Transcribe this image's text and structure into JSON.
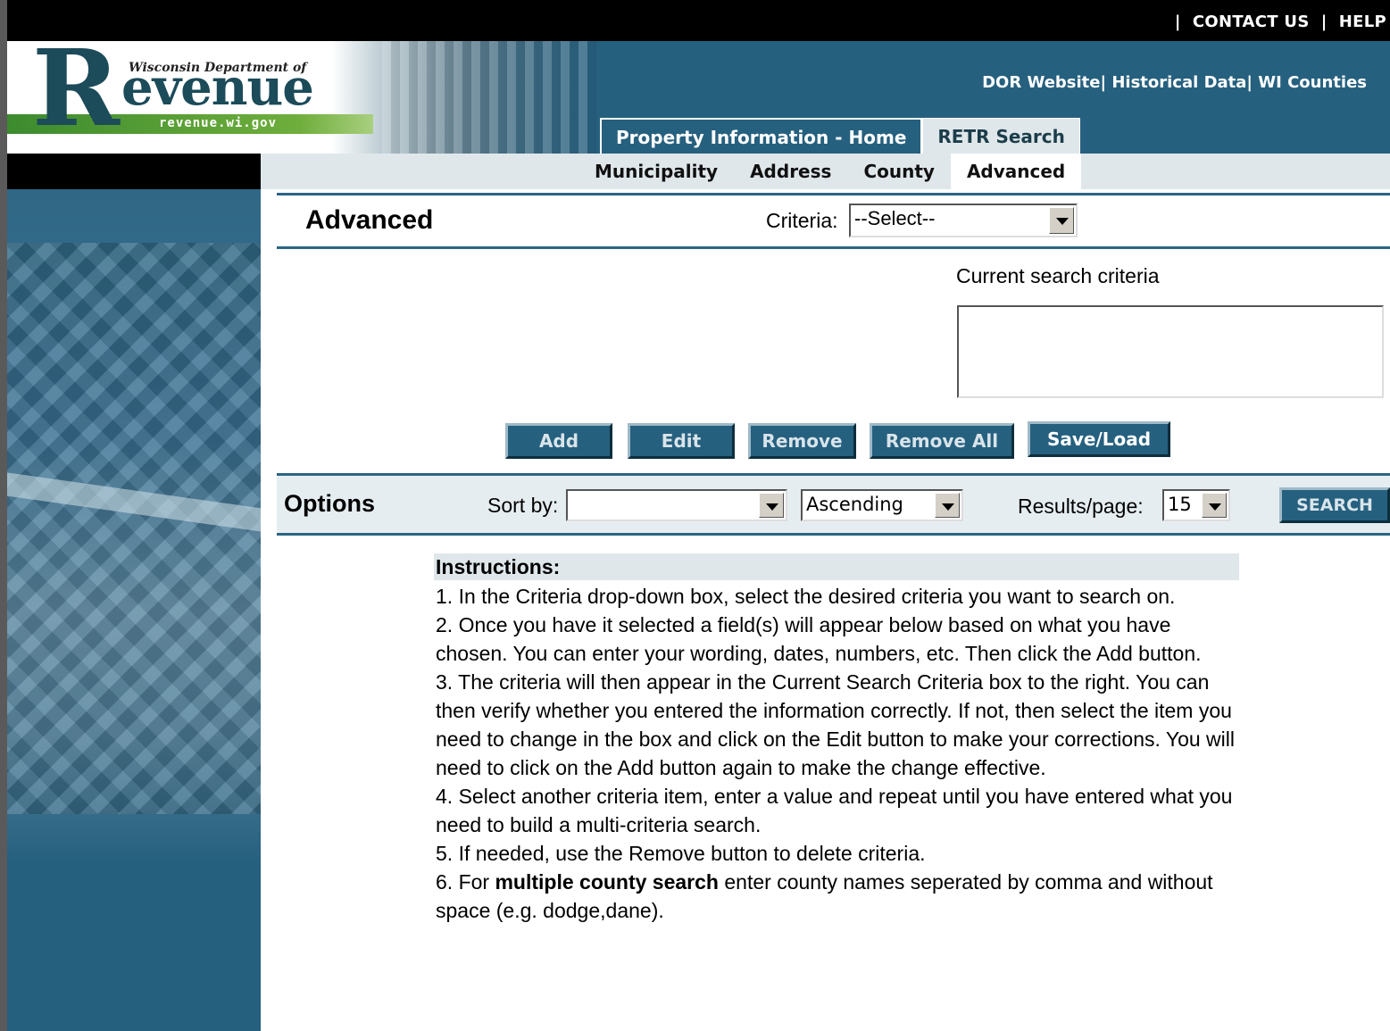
{
  "top_links": {
    "sep1": "|",
    "contact": "CONTACT US",
    "sep2": "|",
    "help": "HELP"
  },
  "logo": {
    "small_text": "Wisconsin Department of",
    "R": "R",
    "evenue": "evenue",
    "url": "revenue.wi.gov"
  },
  "external_links": {
    "dor": "DOR Website|",
    "historical": "Historical Data|",
    "counties": "WI Counties"
  },
  "main_tabs": [
    {
      "label": "Property Information - Home"
    },
    {
      "label": "RETR Search"
    }
  ],
  "sub_tabs": [
    {
      "label": "Municipality"
    },
    {
      "label": "Address"
    },
    {
      "label": "County"
    },
    {
      "label": "Advanced"
    }
  ],
  "advanced": {
    "title": "Advanced",
    "criteria_label": "Criteria:",
    "criteria_value": "--Select--",
    "current_label": "Current search criteria"
  },
  "buttons": {
    "add": "Add",
    "edit": "Edit",
    "remove": "Remove",
    "remove_all": "Remove All",
    "save_load": "Save/Load"
  },
  "options": {
    "title": "Options",
    "sort_label": "Sort by:",
    "sort_value": "",
    "order_value": "Ascending",
    "results_label": "Results/page:",
    "results_value": "15",
    "search": "SEARCH"
  },
  "instructions": {
    "heading": "Instructions:",
    "step1": "1. In the Criteria drop-down box, select the desired criteria you want to search on.",
    "step2": "2. Once you have it selected a field(s) will appear below based on what you have chosen. You can enter your wording, dates, numbers, etc. Then click the Add button.",
    "step3": "3. The criteria will then appear in the Current Search Criteria box to the right. You can then verify whether you entered the information correctly. If not, then select the item you need to change in the box and click on the Edit button to make your corrections. You will need to click on the Add button again to make the change effective.",
    "step4": "4. Select another criteria item, enter a value and repeat until you have entered what you need to build a multi-criteria search.",
    "step5": "5. If needed, use the Remove button to delete criteria.",
    "step6_prefix": "6. For ",
    "step6_bold": "multiple county search",
    "step6_suffix": " enter county names seperated by comma and without space (e.g. dodge,dane)."
  }
}
